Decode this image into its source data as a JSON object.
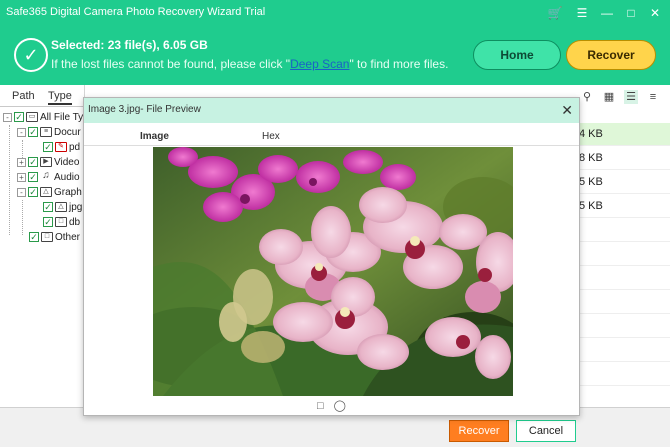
{
  "app": {
    "title": "Safe365 Digital Camera Photo Recovery Wizard Trial",
    "window_icons": [
      "cart-icon",
      "settings-icon",
      "minimize-icon",
      "maximize-icon",
      "close-icon"
    ]
  },
  "header": {
    "selected_text": "Selected: 23 file(s), 6.05 GB",
    "hint_prefix": "If the lost files cannot be found, please click \"",
    "hint_link": "Deep Scan",
    "hint_suffix": "\" to find more files.",
    "home_label": "Home",
    "recover_label": "Recover"
  },
  "sidebar": {
    "tabs": [
      "Path",
      "Type"
    ],
    "tree": [
      {
        "label": "All File Ty",
        "level": 0,
        "expander": "-"
      },
      {
        "label": "Docur",
        "level": 1,
        "expander": "-"
      },
      {
        "label": "pd",
        "level": 2,
        "expander": ""
      },
      {
        "label": "Video",
        "level": 1,
        "expander": "+"
      },
      {
        "label": "Audio",
        "level": 1,
        "expander": "+"
      },
      {
        "label": "Graph",
        "level": 1,
        "expander": "-"
      },
      {
        "label": "jpg",
        "level": 2,
        "expander": ""
      },
      {
        "label": "db",
        "level": 2,
        "expander": ""
      },
      {
        "label": "Other",
        "level": 1,
        "expander": ""
      }
    ]
  },
  "list": {
    "sizes": [
      "4 KB",
      "8 KB",
      "5 KB",
      "5 KB"
    ]
  },
  "dialog": {
    "title": "Image 3.jpg- File Preview",
    "tabs": [
      "Image",
      "Hex"
    ]
  },
  "footer": {
    "recover_label": "Recover",
    "cancel_label": "Cancel"
  },
  "colors": {
    "brand_green": "#1fcc8e",
    "recover_orange": "#ff7e20"
  }
}
